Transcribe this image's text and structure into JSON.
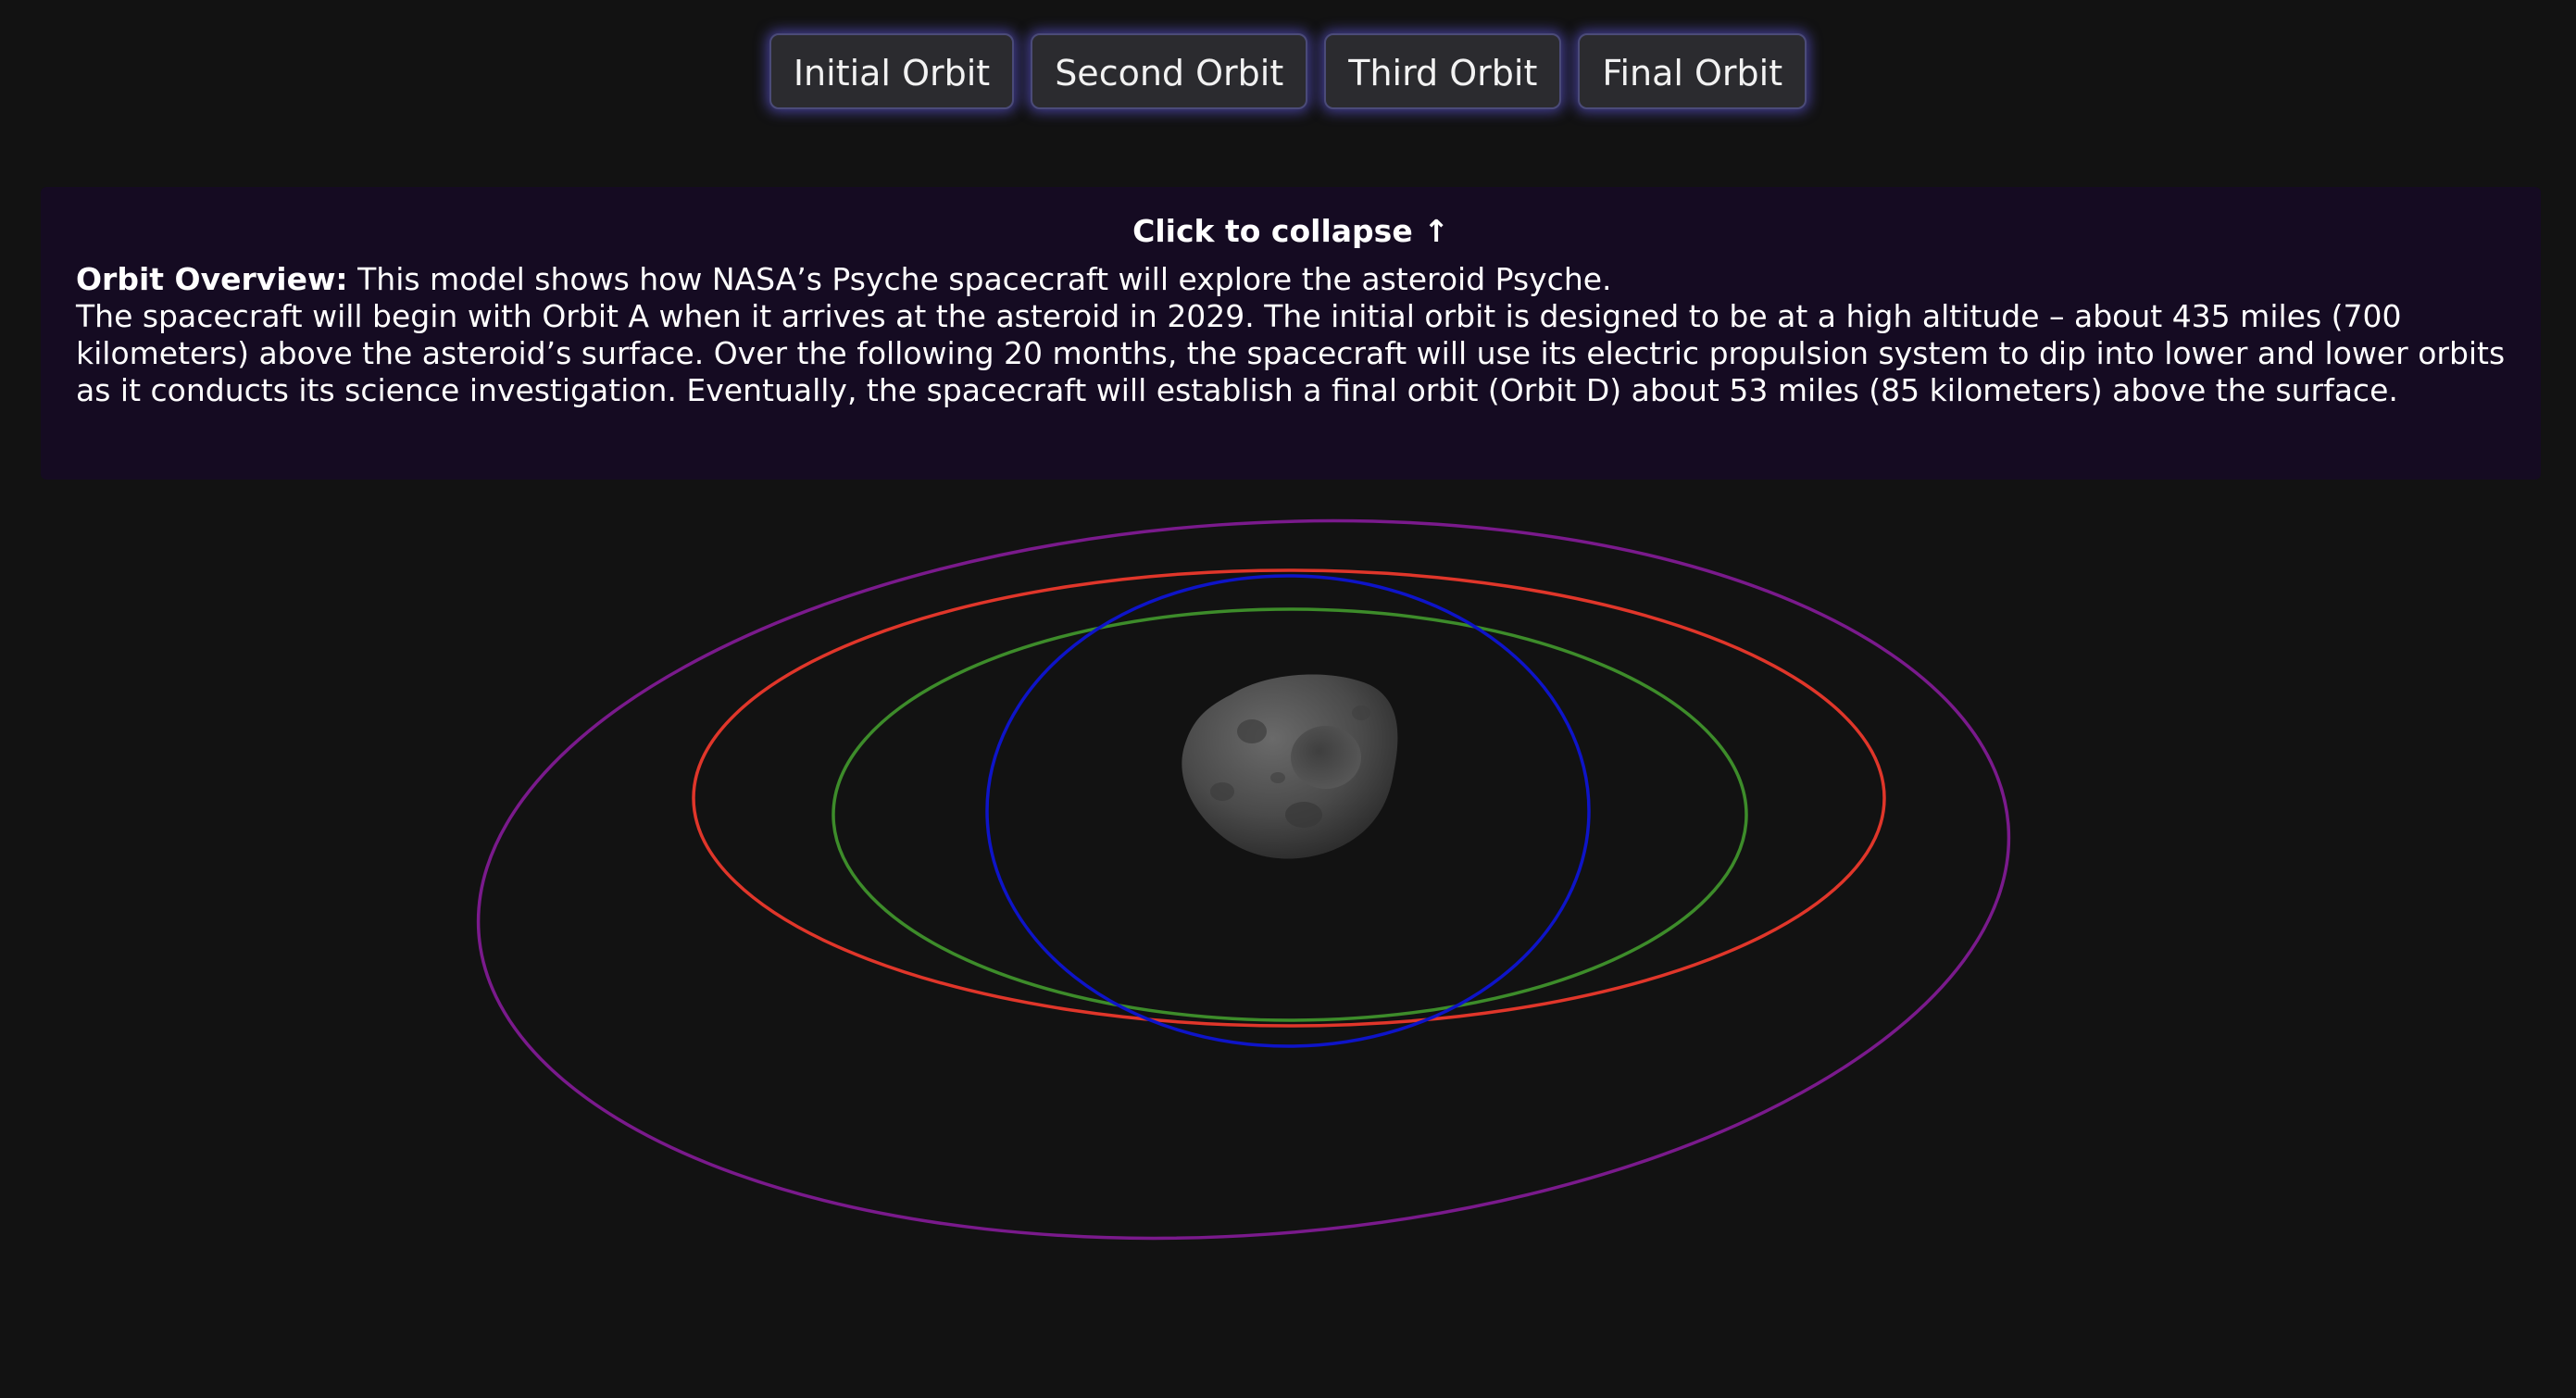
{
  "nav": {
    "buttons": [
      {
        "label": "Initial Orbit"
      },
      {
        "label": "Second Orbit"
      },
      {
        "label": "Third Orbit"
      },
      {
        "label": "Final Orbit"
      }
    ]
  },
  "panel": {
    "collapse_label": "Click to collapse ↑",
    "overview_label": "Orbit Overview:",
    "overview_intro": " This model shows how NASA’s Psyche spacecraft will explore the asteroid Psyche.",
    "overview_body": "The spacecraft will begin with Orbit A when it arrives at the asteroid in 2029. The initial orbit is designed to be at a high altitude – about 435 miles (700 kilometers) above the asteroid’s surface. Over the following 20 months, the spacecraft will use its electric propulsion system to dip into lower and lower orbits as it conducts its science investigation. Eventually, the spacecraft will establish a final orbit (Orbit D) about 53 miles (85 kilometers) above the surface."
  },
  "orbits": {
    "colors": {
      "initial": "#7a1a8c",
      "second": "#e0362a",
      "third": "#3d8c2a",
      "final": "#0e14c8"
    }
  },
  "asteroid": {
    "icon": "asteroid-psyche-icon",
    "color": "#555555"
  }
}
